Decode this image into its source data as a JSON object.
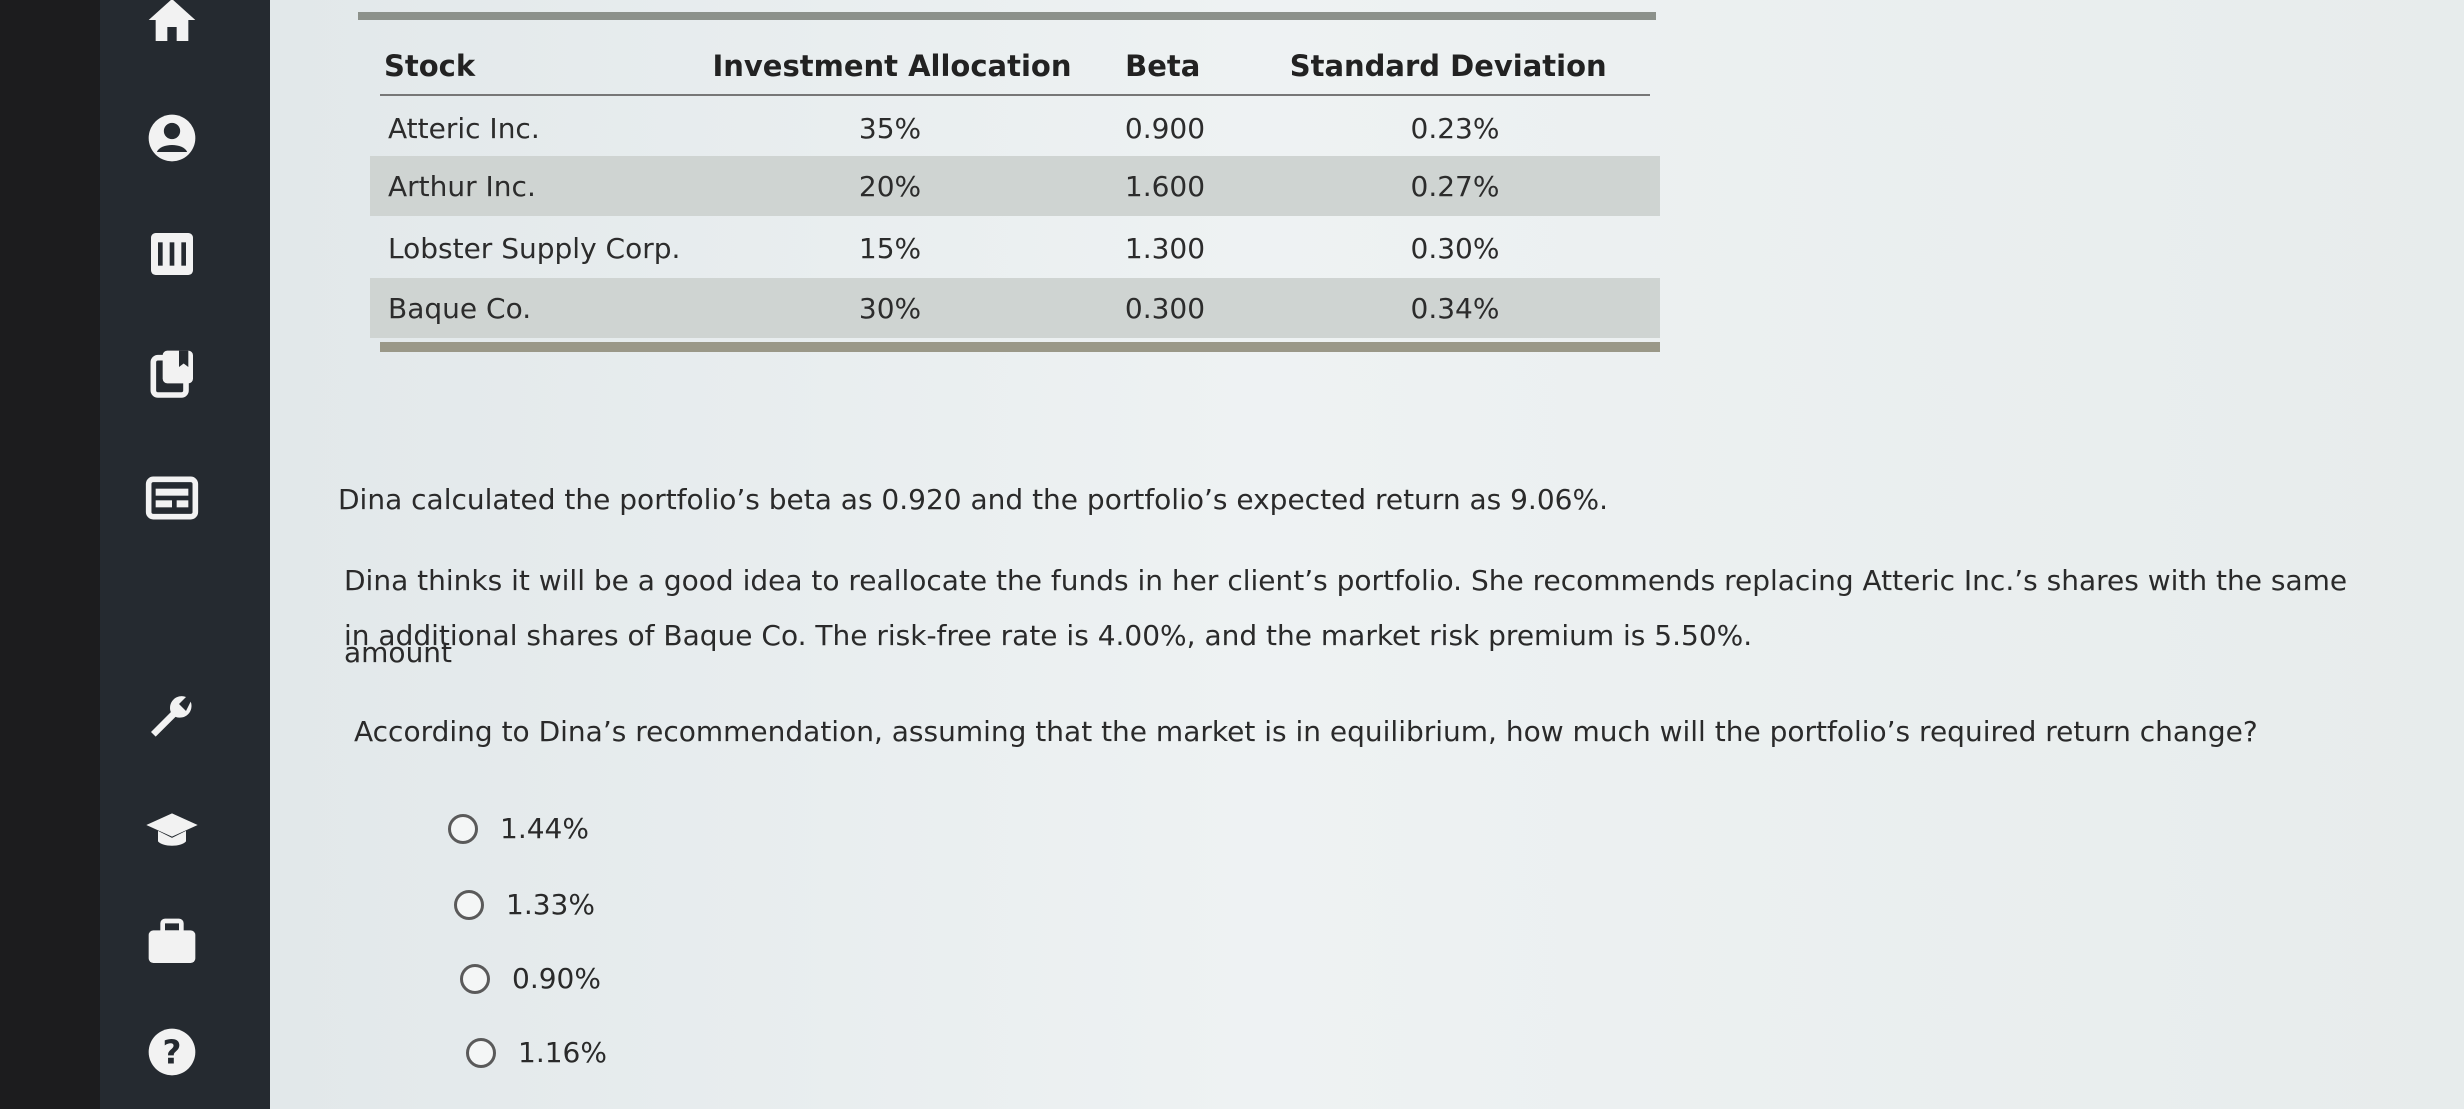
{
  "table": {
    "headers": [
      "Stock",
      "Investment Allocation",
      "Beta",
      "Standard Deviation"
    ],
    "rows": [
      [
        "Atteric Inc.",
        "35%",
        "0.900",
        "0.23%"
      ],
      [
        "Arthur Inc.",
        "20%",
        "1.600",
        "0.27%"
      ],
      [
        "Lobster Supply Corp.",
        "15%",
        "1.300",
        "0.30%"
      ],
      [
        "Baque Co.",
        "30%",
        "0.300",
        "0.34%"
      ]
    ]
  },
  "text": {
    "p1": "Dina calculated the portfolio’s beta as 0.920 and the portfolio’s expected return as 9.06%.",
    "p2_line1": "Dina thinks it will be a good idea to reallocate the funds in her client’s portfolio. She recommends replacing Atteric Inc.’s shares with the same amount",
    "p2_line2": "in additional shares of Baque Co. The risk-free rate is 4.00%, and the market risk premium is 5.50%.",
    "question": "According to Dina’s recommendation, assuming that the market is in equilibrium, how much will the portfolio’s required return change?"
  },
  "options": [
    "1.44%",
    "1.33%",
    "0.90%",
    "1.16%"
  ],
  "sidebar": {
    "icons": [
      "home-icon",
      "user-icon",
      "notes-icon",
      "book-icon",
      "card-icon",
      "wrench-icon",
      "graduation-cap-icon",
      "briefcase-icon",
      "help-icon"
    ]
  }
}
